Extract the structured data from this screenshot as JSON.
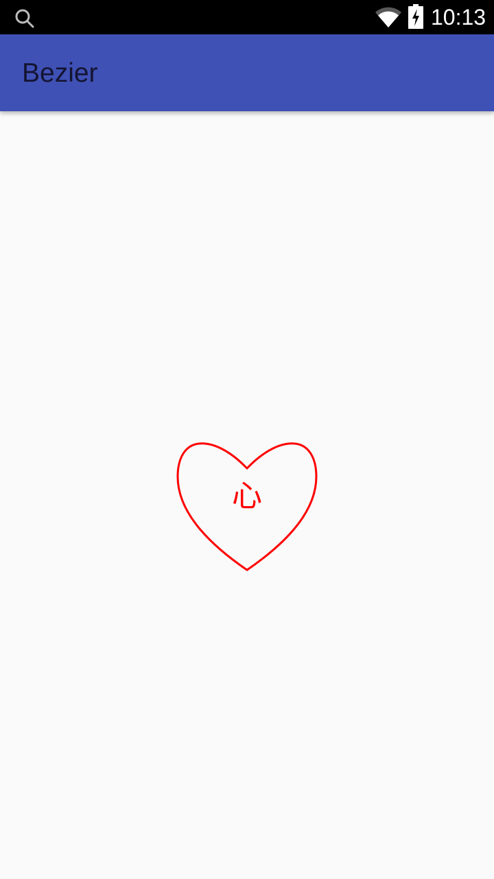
{
  "status_bar": {
    "time": "10:13",
    "icons": [
      "search-icon",
      "wifi-icon",
      "battery-charging-icon"
    ]
  },
  "app_bar": {
    "title": "Bezier",
    "color": "#3f51b5"
  },
  "canvas": {
    "heart_label": "心",
    "heart_color": "#ff0000"
  }
}
